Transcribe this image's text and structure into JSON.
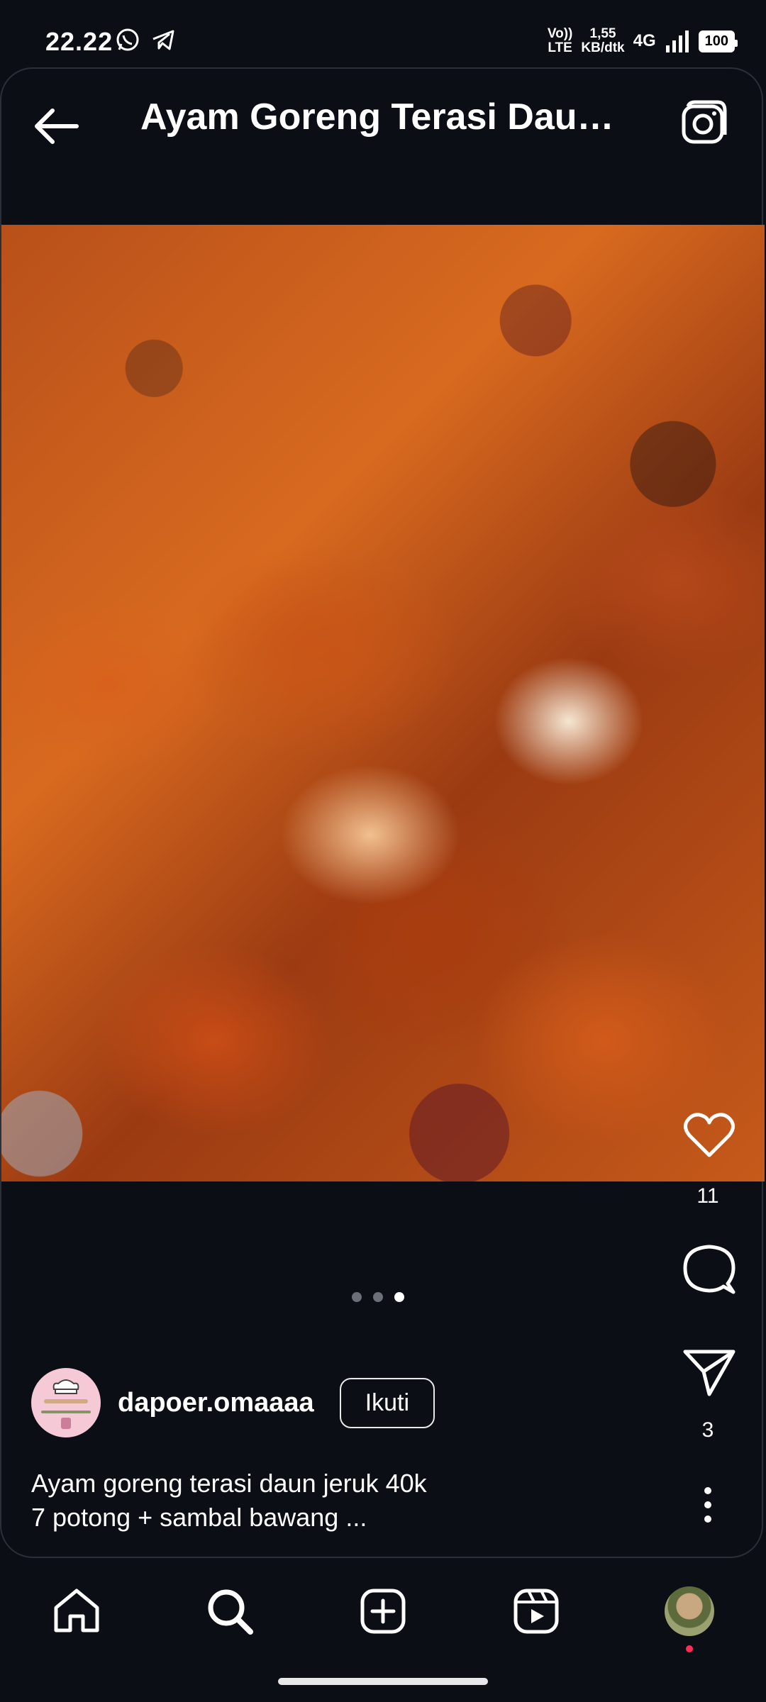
{
  "status": {
    "time": "22.22",
    "volte_top": "Vo))",
    "volte_bottom": "LTE",
    "speed_value": "1,55",
    "speed_unit": "KB/dtk",
    "network": "4G",
    "battery": "100"
  },
  "header": {
    "title": "Ayam Goreng Terasi Daun Jeruk"
  },
  "post": {
    "likes": "11",
    "shares": "3",
    "author": "dapoer.omaaaa",
    "follow_label": "Ikuti",
    "caption_line1": "Ayam goreng terasi daun jeruk 40k",
    "caption_line2": "7 potong + sambal bawang ...",
    "carousel": {
      "count": 3,
      "active_index": 2
    }
  },
  "colors": {
    "background": "#0b0e14",
    "text": "#ffffff",
    "notification": "#ff2d55"
  },
  "icons": {
    "back": "arrow-left-icon",
    "camera": "camera-icon",
    "like": "heart-icon",
    "comment": "comment-icon",
    "share": "send-icon",
    "more": "more-vertical-icon",
    "home": "home-icon",
    "search": "search-icon",
    "create": "plus-square-icon",
    "reels": "reels-icon"
  }
}
